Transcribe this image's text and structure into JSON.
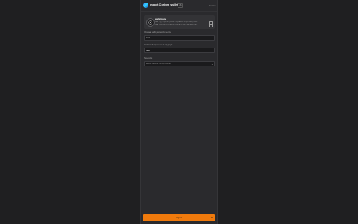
{
  "header": {
    "title": "Import Cosium wallet",
    "badge": "JS",
    "cancel_label": "Cancel"
  },
  "wallet": {
    "name": "walletname",
    "address1_label": "ct1",
    "address1": "1qyzxsq3e7ejz9dk4wtdgr0m9nl7fq0lsd4lxpa8sm",
    "address2_label": "ct2",
    "address2": "0x9f3e2d1c4b5a6f7e8d9c0b1a2f3e4d5c6b7a8f9e",
    "icon": "cosium-wallet-icon",
    "copy_icon": "copy-icon"
  },
  "fields": {
    "password_label": "Choose a wallet password to secure",
    "password_value": "test",
    "confirm_label": "Confirm wallet password by retyping it",
    "confirm_value": "test",
    "storage_label": "Save wallet",
    "storage_value": "Allow access on my device"
  },
  "submit": {
    "label": "Import",
    "arrow": "»"
  },
  "colors": {
    "accent": "#f07a0c",
    "background": "#1f1f21",
    "panel": "#2a2a2d"
  }
}
